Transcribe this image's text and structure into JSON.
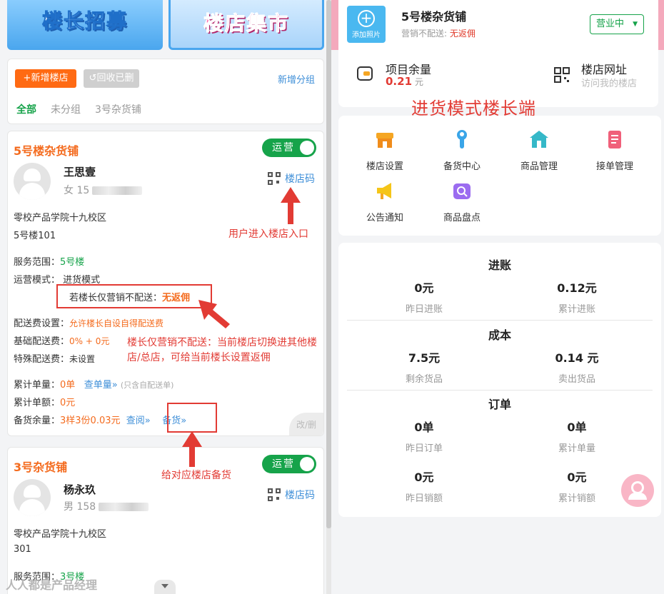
{
  "banners": {
    "left": "楼长招募",
    "right": "楼店集市"
  },
  "filter": {
    "add_store": "+新增楼店",
    "recycle": "↺回收已删",
    "add_group": "新增分组",
    "tabs": [
      "全部",
      "未分组",
      "3号杂货铺"
    ]
  },
  "store1": {
    "title": "5号楼杂货铺",
    "toggle": "运营",
    "owner_name": "王思壹",
    "owner_gender": "女",
    "owner_phone_prefix": "15",
    "qr_label": "楼店码",
    "address_line1": "零校产品学院十九校区",
    "address_line2": "5号楼101",
    "service_label": "服务范围：",
    "service_value": "5号楼",
    "mode_label": "运营模式：",
    "mode_value": "进货模式",
    "no_delivery_label": "若楼长仅营销不配送：",
    "no_delivery_value": "无返佣",
    "fee_setting_label": "配送费设置：",
    "fee_setting_value": "允许楼长自设自得配送费",
    "base_fee_label": "基础配送费：",
    "base_fee_value": "0% + 0元",
    "special_fee_label": "特殊配送费：",
    "special_fee_value": "未设置",
    "total_orders_label": "累计单量：",
    "total_orders_value": "0单",
    "check_orders": "查单量»",
    "check_orders_note": "(只含自配送单)",
    "total_amount_label": "累计单额：",
    "total_amount_value": "0元",
    "stock_label": "备货余量：",
    "stock_value": "3样3份0.03元",
    "stock_view": "查阅»",
    "stock_restock": "备货»",
    "corner": "改/删"
  },
  "store2": {
    "title": "3号杂货铺",
    "toggle": "运营",
    "owner_name": "杨永玖",
    "owner_gender": "男",
    "owner_phone_prefix": "158",
    "qr_label": "楼店码",
    "address_line1": "零校产品学院十九校区",
    "address_line2": "301",
    "service_label": "服务范围：",
    "service_value": "3号楼"
  },
  "annotations": {
    "qr_entry": "用户进入楼店入口",
    "no_delivery": "楼长仅营销不配送：当前楼店切换进其他楼店/总店，可给当前楼长设置返佣",
    "restock": "给对应楼店备货"
  },
  "watermark": "人人都是产品经理",
  "right": {
    "add_photo": "添加照片",
    "shop_name": "5号楼杂货铺",
    "shop_sub_label": "营销不配送:",
    "shop_sub_value": "无返佣",
    "status": "营业中",
    "balance_label": "项目余量",
    "balance_value": "0.21",
    "balance_unit": "元",
    "url_label": "楼店网址",
    "url_sub": "访问我的楼店",
    "big_title": "进货模式楼长端",
    "menu": [
      "楼店设置",
      "备货中心",
      "商品管理",
      "接单管理",
      "公告通知",
      "商品盘点"
    ],
    "stats": {
      "income": {
        "title": "进账",
        "v1": "0元",
        "l1": "昨日进账",
        "v2": "0.12元",
        "l2": "累计进账"
      },
      "cost": {
        "title": "成本",
        "v1": "7.5元",
        "l1": "剩余货品",
        "v2": "0.14 元",
        "l2": "卖出货品"
      },
      "orders": {
        "title": "订单",
        "v1": "0单",
        "l1": "昨日订单",
        "v2": "0单",
        "l2": "累计单量",
        "v3": "0元",
        "l3": "昨日销额",
        "v4": "0元",
        "l4": "累计销额"
      }
    }
  },
  "colors": {
    "accent_orange": "#ff6a13",
    "green": "#16a34a",
    "annotation_red": "#e23b34",
    "link_blue": "#3f8fd8"
  },
  "icons": [
    "qr-code-icon",
    "plus-icon",
    "wallet-icon",
    "store-icon",
    "wrench-icon",
    "house-icon",
    "clipboard-icon",
    "megaphone-icon",
    "search-bag-icon",
    "customer-service-icon",
    "chevron-down-icon"
  ]
}
